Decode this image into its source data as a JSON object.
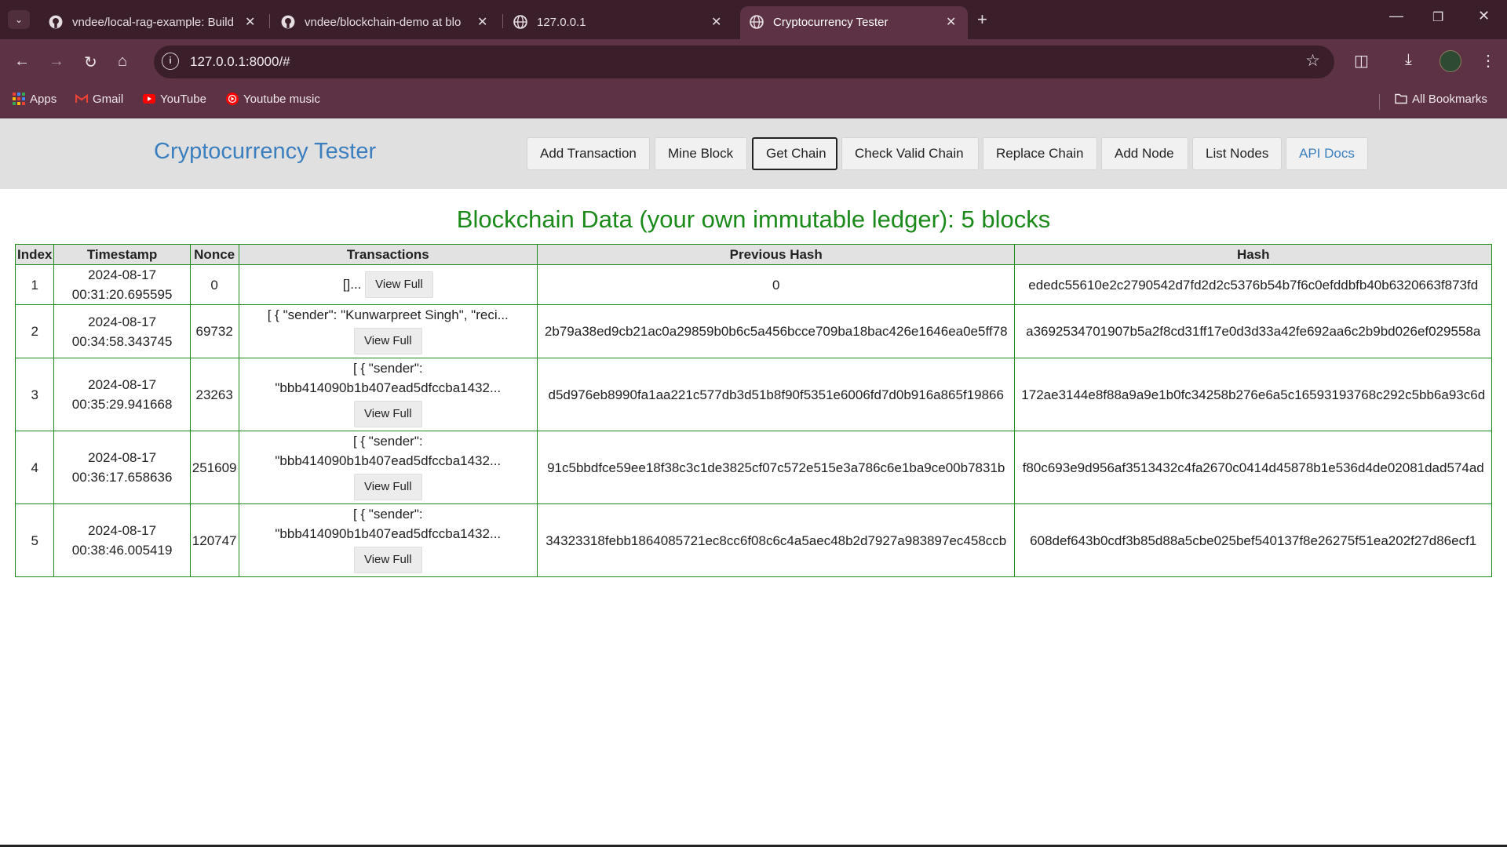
{
  "browser": {
    "tabs": [
      {
        "title": "vndee/local-rag-example: Build",
        "icon": "github-icon"
      },
      {
        "title": "vndee/blockchain-demo at blo",
        "icon": "github-icon"
      },
      {
        "title": "127.0.0.1",
        "icon": "globe-icon"
      },
      {
        "title": "Cryptocurrency Tester",
        "icon": "globe-icon",
        "active": true
      }
    ],
    "url": "127.0.0.1:8000/#",
    "bookmarks": [
      {
        "label": "Apps",
        "icon": "apps-grid-icon"
      },
      {
        "label": "Gmail",
        "icon": "gmail-icon"
      },
      {
        "label": "YouTube",
        "icon": "youtube-icon"
      },
      {
        "label": "Youtube music",
        "icon": "youtube-music-icon"
      }
    ],
    "all_bookmarks": "All Bookmarks"
  },
  "page": {
    "brand": "Cryptocurrency Tester",
    "nav": {
      "add_transaction": "Add Transaction",
      "mine_block": "Mine Block",
      "get_chain": "Get Chain",
      "check_valid_chain": "Check Valid Chain",
      "replace_chain": "Replace Chain",
      "add_node": "Add Node",
      "list_nodes": "List Nodes",
      "api_docs": "API Docs"
    },
    "heading": "Blockchain Data (your own immutable ledger): 5 blocks",
    "table": {
      "headers": {
        "index": "Index",
        "timestamp": "Timestamp",
        "nonce": "Nonce",
        "transactions": "Transactions",
        "previous_hash": "Previous Hash",
        "hash": "Hash"
      },
      "view_full": "View Full",
      "rows": [
        {
          "index": "1",
          "date": "2024-08-17",
          "time": "00:31:20.695595",
          "nonce": "0",
          "tx1": "[]...",
          "tx2": "",
          "previous_hash": "0",
          "hash": "ededc55610e2c2790542d7fd2d2c5376b54b7f6c0efddbfb40b6320663f873fd"
        },
        {
          "index": "2",
          "date": "2024-08-17",
          "time": "00:34:58.343745",
          "nonce": "69732",
          "tx1": "[ { \"sender\": \"Kunwarpreet Singh\", \"reci...",
          "tx2": "",
          "previous_hash": "2b79a38ed9cb21ac0a29859b0b6c5a456bcce709ba18bac426e1646ea0e5ff78",
          "hash": "a3692534701907b5a2f8cd31ff17e0d3d33a42fe692aa6c2b9bd026ef029558a"
        },
        {
          "index": "3",
          "date": "2024-08-17",
          "time": "00:35:29.941668",
          "nonce": "23263",
          "tx1": "[ { \"sender\":",
          "tx2": "\"bbb414090b1b407ead5dfccba1432...",
          "previous_hash": "d5d976eb8990fa1aa221c577db3d51b8f90f5351e6006fd7d0b916a865f19866",
          "hash": "172ae3144e8f88a9a9e1b0fc34258b276e6a5c16593193768c292c5bb6a93c6d"
        },
        {
          "index": "4",
          "date": "2024-08-17",
          "time": "00:36:17.658636",
          "nonce": "251609",
          "tx1": "[ { \"sender\":",
          "tx2": "\"bbb414090b1b407ead5dfccba1432...",
          "previous_hash": "91c5bbdfce59ee18f38c3c1de3825cf07c572e515e3a786c6e1ba9ce00b7831b",
          "hash": "f80c693e9d956af3513432c4fa2670c0414d45878b1e536d4de02081dad574ad"
        },
        {
          "index": "5",
          "date": "2024-08-17",
          "time": "00:38:46.005419",
          "nonce": "120747",
          "tx1": "[ { \"sender\":",
          "tx2": "\"bbb414090b1b407ead5dfccba1432...",
          "previous_hash": "34323318febb1864085721ec8cc6f08c6c4a5aec48b2d7927a983897ec458ccb",
          "hash": "608def643b0cdf3b85d88a5cbe025bef540137f8e26275f51ea202f27d86ecf1"
        }
      ]
    }
  }
}
